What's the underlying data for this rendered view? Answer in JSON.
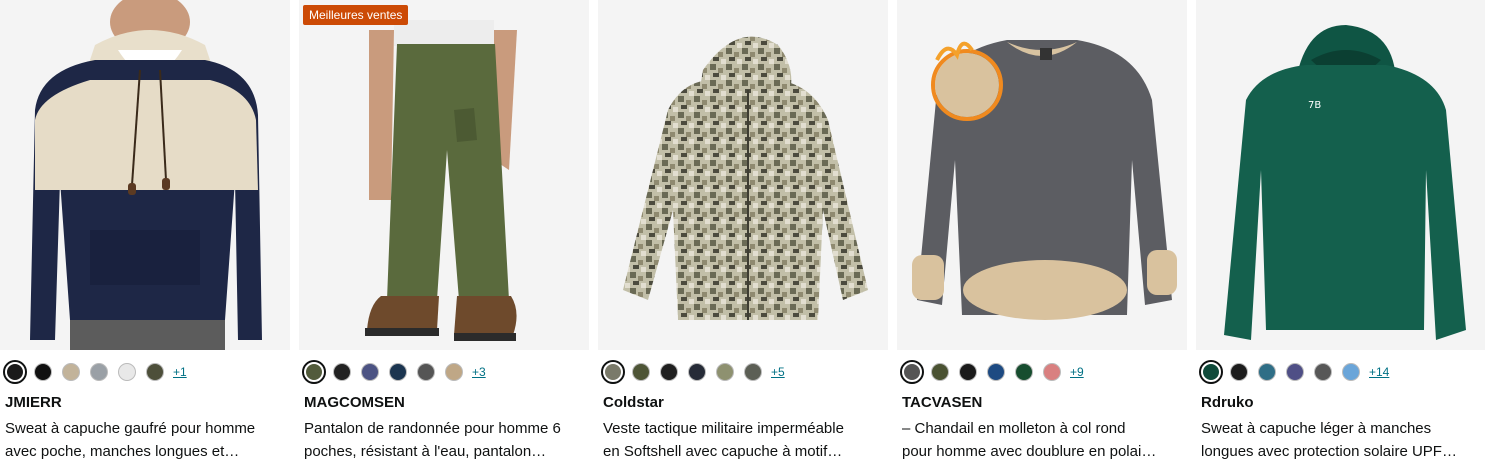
{
  "products": [
    {
      "brand": "JMIERR",
      "title_line1": "Sweat à capuche gaufré pour homme",
      "title_line2": "avec poche, manches longues et…",
      "more_colors": "+1",
      "badge": null,
      "swatches": [
        "#1a1a1a",
        "#111111",
        "#c2b39a",
        "#9aa0a6",
        "#e8e8e8",
        "#4d4f3a"
      ]
    },
    {
      "brand": "MAGCOMSEN",
      "title_line1": "Pantalon de randonnée pour homme 6",
      "title_line2": "poches, résistant à l'eau, pantalon…",
      "more_colors": "+3",
      "badge": "Meilleures ventes",
      "swatches": [
        "#525b3b",
        "#222222",
        "#4c5383",
        "#1b3550",
        "#555555",
        "#bfa786"
      ]
    },
    {
      "brand": "Coldstar",
      "title_line1": "Veste tactique militaire imperméable",
      "title_line2": "en Softshell avec capuche à motif…",
      "more_colors": "+5",
      "badge": null,
      "swatches": [
        "#7a7a6a",
        "#4e5536",
        "#1f1f1f",
        "#262b37",
        "#8e9170",
        "#5c5f55"
      ]
    },
    {
      "brand": "TACVASEN",
      "title_line1": "– Chandail en molleton à col rond",
      "title_line2": "pour homme avec doublure en polai…",
      "more_colors": "+9",
      "badge": null,
      "swatches": [
        "#555555",
        "#4a5232",
        "#1a1a1a",
        "#1d4a82",
        "#174d2f",
        "#d98080"
      ]
    },
    {
      "brand": "Rdruko",
      "title_line1": "Sweat à capuche léger à manches",
      "title_line2": "longues avec protection solaire UPF…",
      "more_colors": "+14",
      "badge": null,
      "swatches": [
        "#0f4a3a",
        "#1c1c1c",
        "#2f6e86",
        "#4f4f86",
        "#575757",
        "#6aa5d9"
      ]
    }
  ],
  "colors": {
    "link": "#007185",
    "badge": "#cc4a05",
    "image_bg": "#f7f7f7"
  }
}
